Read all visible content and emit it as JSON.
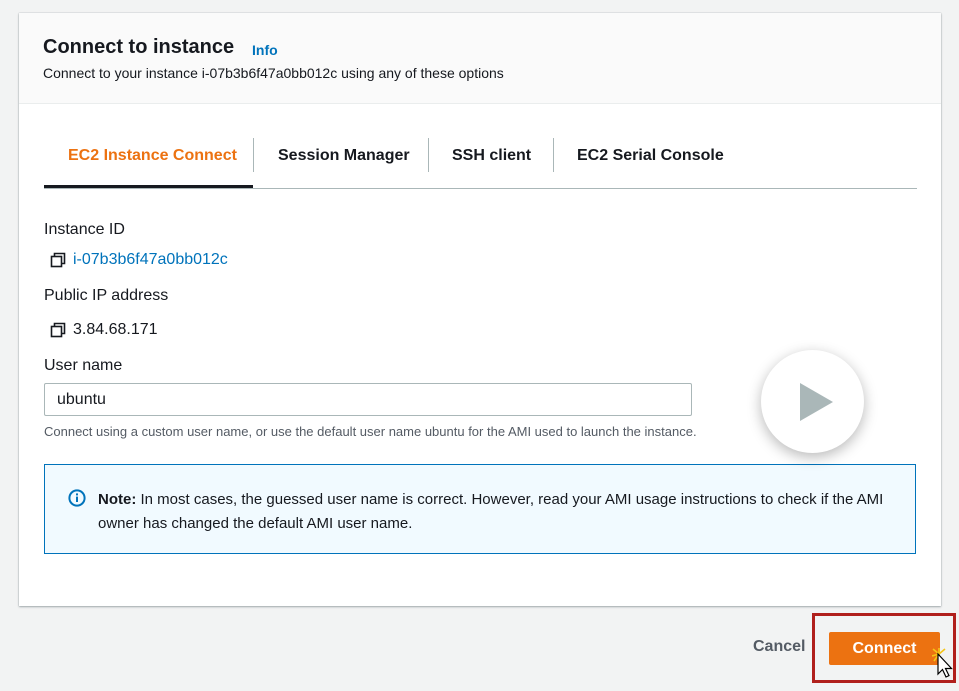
{
  "header": {
    "title": "Connect to instance",
    "info": "Info",
    "subtitle": "Connect to your instance i-07b3b6f47a0bb012c using any of these options"
  },
  "tabs": [
    {
      "label": "EC2 Instance Connect",
      "active": true
    },
    {
      "label": "Session Manager",
      "active": false
    },
    {
      "label": "SSH client",
      "active": false
    },
    {
      "label": "EC2 Serial Console",
      "active": false
    }
  ],
  "instance": {
    "id_label": "Instance ID",
    "id_value": "i-07b3b6f47a0bb012c",
    "ip_label": "Public IP address",
    "ip_value": "3.84.68.171",
    "copy_icon": "copy-icon"
  },
  "username": {
    "label": "User name",
    "value": "ubuntu",
    "hint": "Connect using a custom user name, or use the default user name ubuntu for the AMI used to launch the instance."
  },
  "note": {
    "icon": "info-icon",
    "bold": "Note:",
    "text": " In most cases, the guessed user name is correct. However, read your AMI usage instructions to check if the AMI owner has changed the default AMI user name."
  },
  "overlay": {
    "icon": "play-icon"
  },
  "actions": {
    "cancel": "Cancel",
    "connect": "Connect"
  },
  "colors": {
    "accent": "#ec7211",
    "link": "#0073bb",
    "highlight": "#b0201c",
    "note_bg": "#f1faff"
  }
}
